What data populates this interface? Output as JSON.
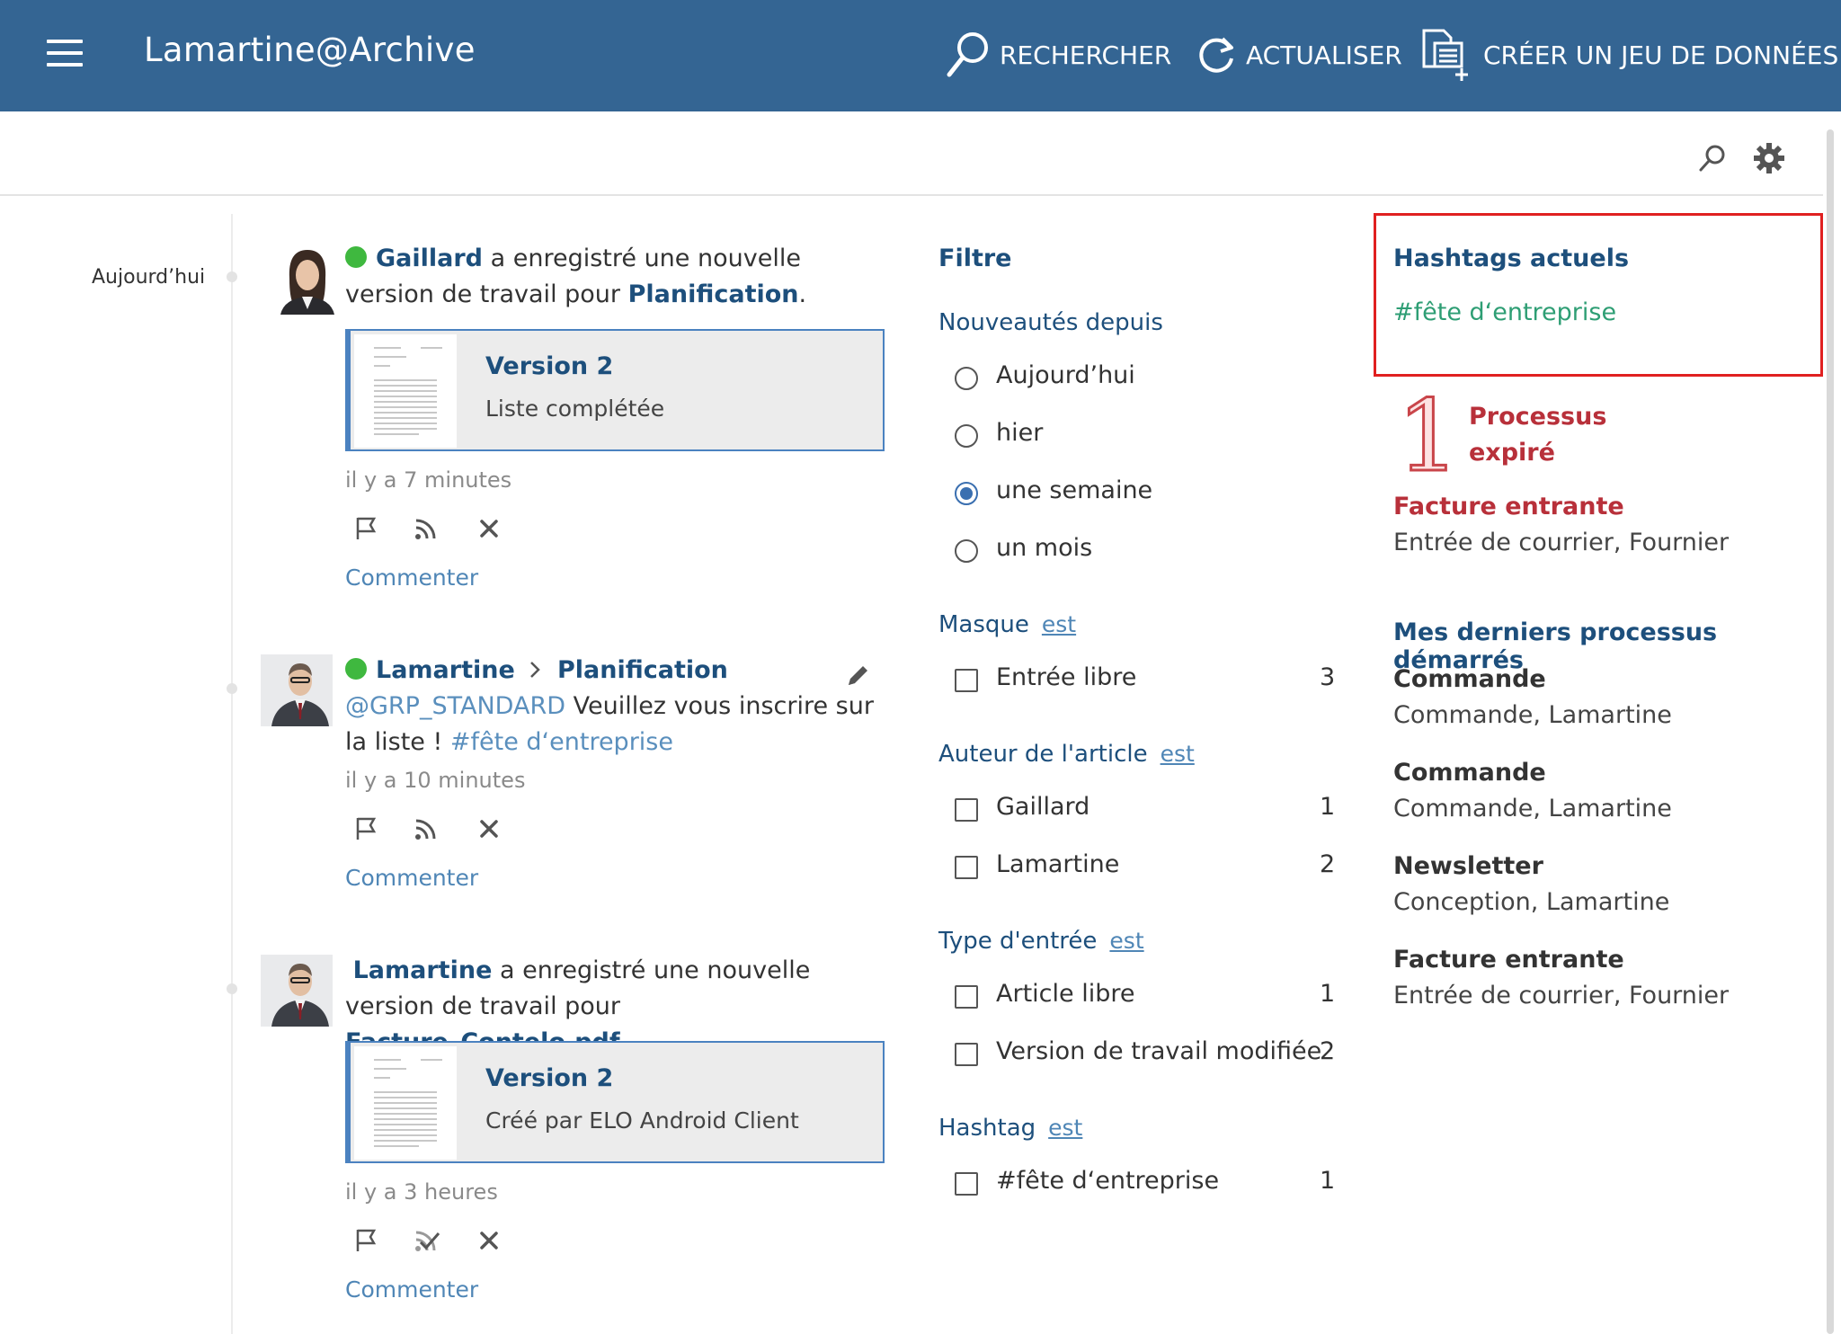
{
  "app": {
    "title": "Lamartine@Archive"
  },
  "topbar": {
    "search_label": "RECHERCHER",
    "refresh_label": "ACTUALISER",
    "create_label": "CRÉER UN JEU DE DONNÉES"
  },
  "timeline": {
    "day_label": "Aujourd’hui"
  },
  "feed": [
    {
      "author": "Gaillard",
      "text_a": " a enregistré une nouvelle version de travail pour ",
      "target": "Planification",
      "suffix": ".",
      "card_title": "Version 2",
      "card_sub": "Liste complétée",
      "time": "il y a 7 minutes",
      "comment": "Commenter"
    },
    {
      "author": "Lamartine",
      "target": "Planification",
      "mention": "@GRP_STANDARD",
      "text_a": " Veuillez vous inscrire sur la liste ! ",
      "hashtag": "#fête d‘entreprise",
      "time": "il y a 10 minutes",
      "comment": "Commenter"
    },
    {
      "author": "Lamartine",
      "text_a": " a enregistré une nouvelle version de travail pour ",
      "target": "Facture_Contelo.pdf",
      "suffix": ".",
      "card_title": "Version 2",
      "card_sub": "Créé par ELO Android Client",
      "time": "il y a 3 heures",
      "comment": "Commenter"
    }
  ],
  "filter": {
    "title": "Filtre",
    "since_label": "Nouveautés depuis",
    "since_options": [
      "Aujourd’hui",
      "hier",
      "une semaine",
      "un mois"
    ],
    "since_selected": "une semaine",
    "est": "est",
    "groups": [
      {
        "label": "Masque",
        "items": [
          {
            "label": "Entrée libre",
            "count": "3"
          }
        ]
      },
      {
        "label": "Auteur de l'article",
        "items": [
          {
            "label": "Gaillard",
            "count": "1"
          },
          {
            "label": "Lamartine",
            "count": "2"
          }
        ]
      },
      {
        "label": "Type d'entrée",
        "items": [
          {
            "label": "Article libre",
            "count": "1"
          },
          {
            "label": "Version de travail modifiée",
            "count": "2"
          }
        ]
      },
      {
        "label": "Hashtag",
        "items": [
          {
            "label": "#fête d‘entreprise",
            "count": "1"
          }
        ]
      }
    ]
  },
  "right": {
    "hashtags_title": "Hashtags actuels",
    "hashtag": "#fête d‘entreprise",
    "expired_count": "1",
    "expired_label_1": "Processus",
    "expired_label_2": "expiré",
    "expired_item_title": "Facture entrante",
    "expired_item_sub": "Entrée de courrier, Fournier",
    "recent_title": "Mes derniers processus démarrés",
    "recent": [
      {
        "title": "Commande",
        "sub": "Commande, Lamartine"
      },
      {
        "title": "Commande",
        "sub": "Commande, Lamartine"
      },
      {
        "title": "Newsletter",
        "sub": "Conception, Lamartine"
      },
      {
        "title": "Facture entrante",
        "sub": "Entrée de courrier, Fournier"
      }
    ]
  },
  "colors": {
    "topbar": "#346593",
    "link": "#1d4f7c",
    "hashtag_green": "#2e9e74",
    "alert_red": "#b8303a",
    "online": "#3fb83f"
  }
}
